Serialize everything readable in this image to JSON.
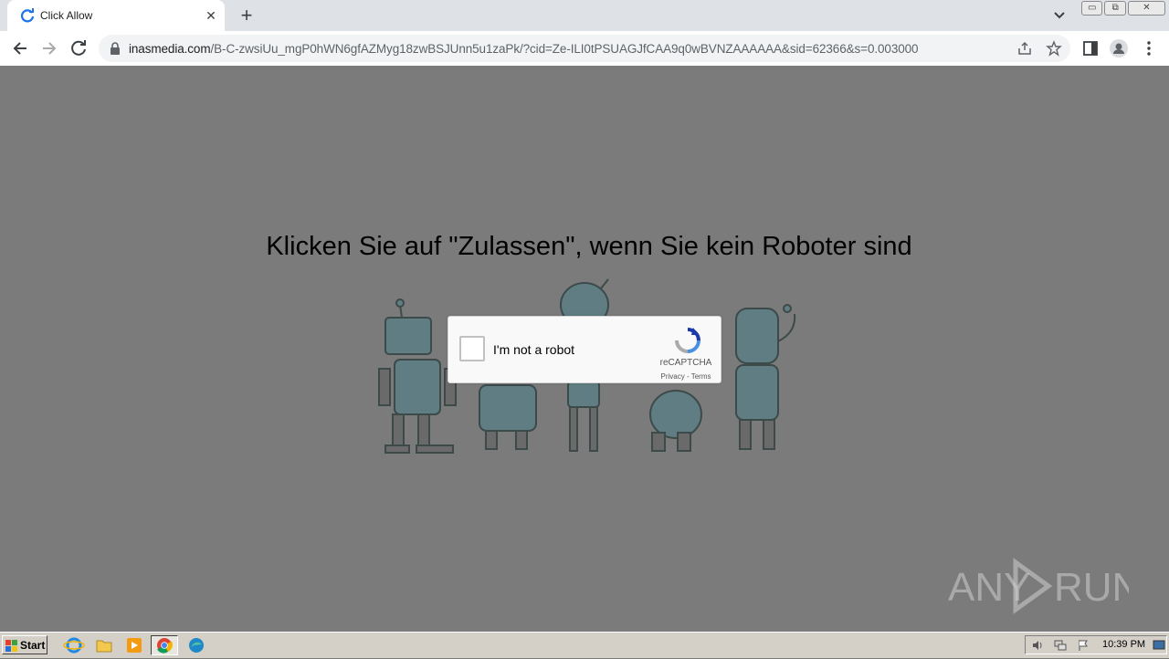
{
  "browser": {
    "tab_title": "Click Allow",
    "tab_close": "✕",
    "new_tab": "+",
    "url_host": "inasmedia.com",
    "url_rest": "/B-C-zwsiUu_mgP0hWN6gfAZMyg18zwBSJUnn5u1zaPk/?cid=Ze-ILI0tPSUAGJfCAA9q0wBVNZAAAAAA&sid=62366&s=0.003000"
  },
  "page": {
    "headline": "Klicken Sie auf \"Zulassen\", wenn Sie kein Roboter sind",
    "captcha_label": "I'm not a robot",
    "captcha_brand": "reCAPTCHA",
    "captcha_privacy": "Privacy",
    "captcha_sep": " - ",
    "captcha_terms": "Terms",
    "watermark": "ANY RUN"
  },
  "taskbar": {
    "start_label": "Start",
    "clock": "10:39 PM"
  },
  "colors": {
    "page_bg": "#7b7b7b",
    "recaptcha_blue": "#4a90e2"
  }
}
